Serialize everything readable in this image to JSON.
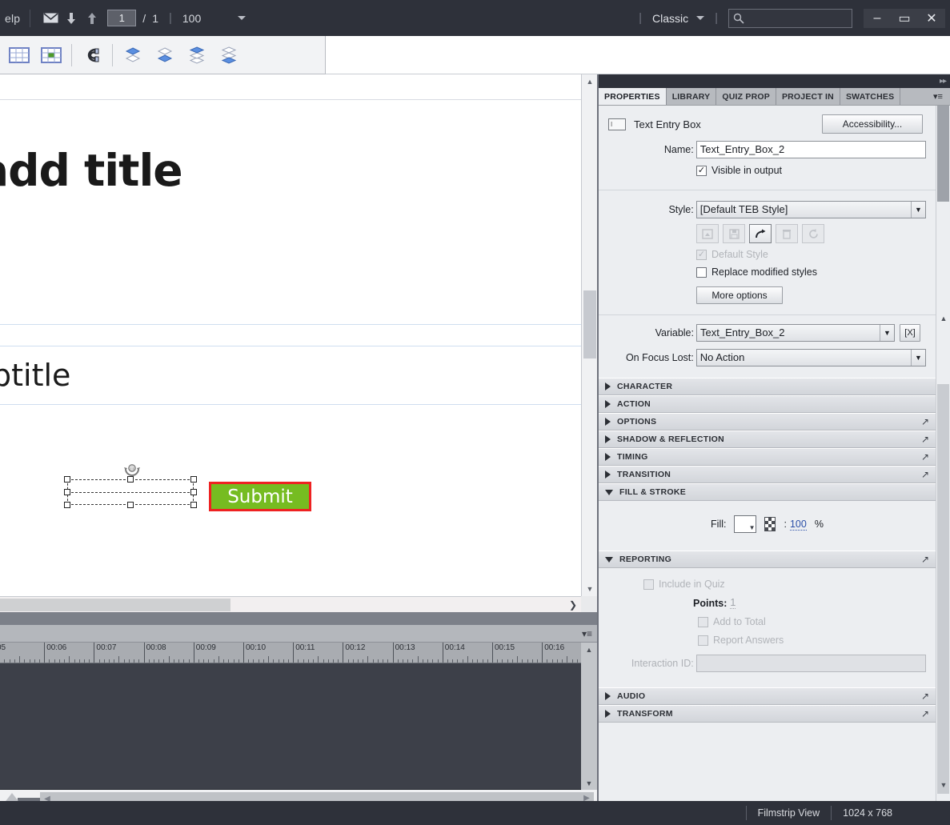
{
  "topbar": {
    "menu_label": "elp",
    "icons": [
      "mail-icon",
      "arrow-down-icon",
      "arrow-up-icon"
    ],
    "page_current": "1",
    "page_separator": "/",
    "page_total": "1",
    "divider": "|",
    "zoom_value": "100",
    "workspace_label": "Classic",
    "search_value": "",
    "search_placeholder": "",
    "window_minimize": "–",
    "window_maximize": "▭",
    "window_close": "✕"
  },
  "toolbar2": {
    "buttons": [
      {
        "name": "grid-icon",
        "label": "Grid"
      },
      {
        "name": "snap-to-grid-icon",
        "label": "Snap to Grid"
      },
      {
        "name": "magnet-icon",
        "label": "Snap to Object"
      },
      {
        "name": "bring-to-front-icon",
        "label": "Bring to Front"
      },
      {
        "name": "send-to-back-icon",
        "label": "Send to Back"
      },
      {
        "name": "bring-forward-icon",
        "label": "Bring Forward"
      },
      {
        "name": "send-backward-icon",
        "label": "Send Backward"
      }
    ]
  },
  "slide": {
    "title": "add title",
    "subtitle": "btitle",
    "submit_button": "Submit",
    "rotate_handle": "rotate-handle-icon"
  },
  "timeline": {
    "ruler_labels": [
      "05",
      "00:06",
      "00:07",
      "00:08",
      "00:09",
      "00:10",
      "00:11",
      "00:12",
      "00:13",
      "00:14",
      "00:15",
      "00:16"
    ],
    "menu_icon": "panel-menu-icon"
  },
  "panel": {
    "tabs": [
      {
        "label": "PROPERTIES",
        "active": true
      },
      {
        "label": "LIBRARY",
        "active": false
      },
      {
        "label": "QUIZ PROP",
        "active": false
      },
      {
        "label": "PROJECT IN",
        "active": false
      },
      {
        "label": "SWATCHES",
        "active": false
      }
    ],
    "object_type": "Text Entry Box",
    "accessibility_button": "Accessibility...",
    "name_label": "Name:",
    "name_value": "Text_Entry_Box_2",
    "visible_in_output": "Visible in output",
    "visible_in_output_checked": true,
    "style_label": "Style:",
    "style_value": "[Default TEB Style]",
    "style_buttons": [
      {
        "name": "apply-style-icon",
        "enabled": false
      },
      {
        "name": "save-style-icon",
        "enabled": false
      },
      {
        "name": "create-new-style-icon",
        "enabled": true
      },
      {
        "name": "delete-style-icon",
        "enabled": false
      },
      {
        "name": "reset-style-icon",
        "enabled": false
      }
    ],
    "default_style": "Default Style",
    "default_style_checked": true,
    "replace_modified_styles": "Replace modified styles",
    "replace_modified_styles_checked": false,
    "more_options_button": "More options",
    "variable_label": "Variable:",
    "variable_value": "Text_Entry_Box_2",
    "variable_clear": "[X]",
    "on_focus_lost_label": "On Focus Lost:",
    "on_focus_lost_value": "No Action",
    "sections": [
      {
        "title": "CHARACTER",
        "expanded": false,
        "has_action": false
      },
      {
        "title": "ACTION",
        "expanded": false,
        "has_action": false
      },
      {
        "title": "OPTIONS",
        "expanded": false,
        "has_action": true
      },
      {
        "title": "SHADOW & REFLECTION",
        "expanded": false,
        "has_action": true
      },
      {
        "title": "TIMING",
        "expanded": false,
        "has_action": true
      },
      {
        "title": "TRANSITION",
        "expanded": false,
        "has_action": true
      }
    ],
    "fill_stroke": {
      "title": "FILL & STROKE",
      "fill_label": "Fill:",
      "fill_opacity": "100",
      "percent_symbol": "%",
      "alpha_icon": "checker-alpha-icon"
    },
    "reporting": {
      "title": "REPORTING",
      "include_in_quiz": "Include in Quiz",
      "include_in_quiz_checked": false,
      "points_label": "Points:",
      "points_value": "1",
      "add_to_total": "Add to Total",
      "add_to_total_checked": false,
      "report_answers": "Report Answers",
      "report_answers_checked": false,
      "interaction_id_label": "Interaction ID:",
      "interaction_id_value": ""
    },
    "sections_bottom": [
      {
        "title": "AUDIO",
        "expanded": false,
        "has_action": true
      },
      {
        "title": "TRANSFORM",
        "expanded": false,
        "has_action": true
      }
    ]
  },
  "statusbar": {
    "view_mode": "Filmstrip View",
    "dimensions": "1024 x 768"
  },
  "colors": {
    "accent_green": "#76bc21",
    "accent_red": "#ee2222",
    "panel_bg": "#eceef1",
    "chrome_dark": "#2e313a",
    "link_blue": "#2b4fa8"
  }
}
